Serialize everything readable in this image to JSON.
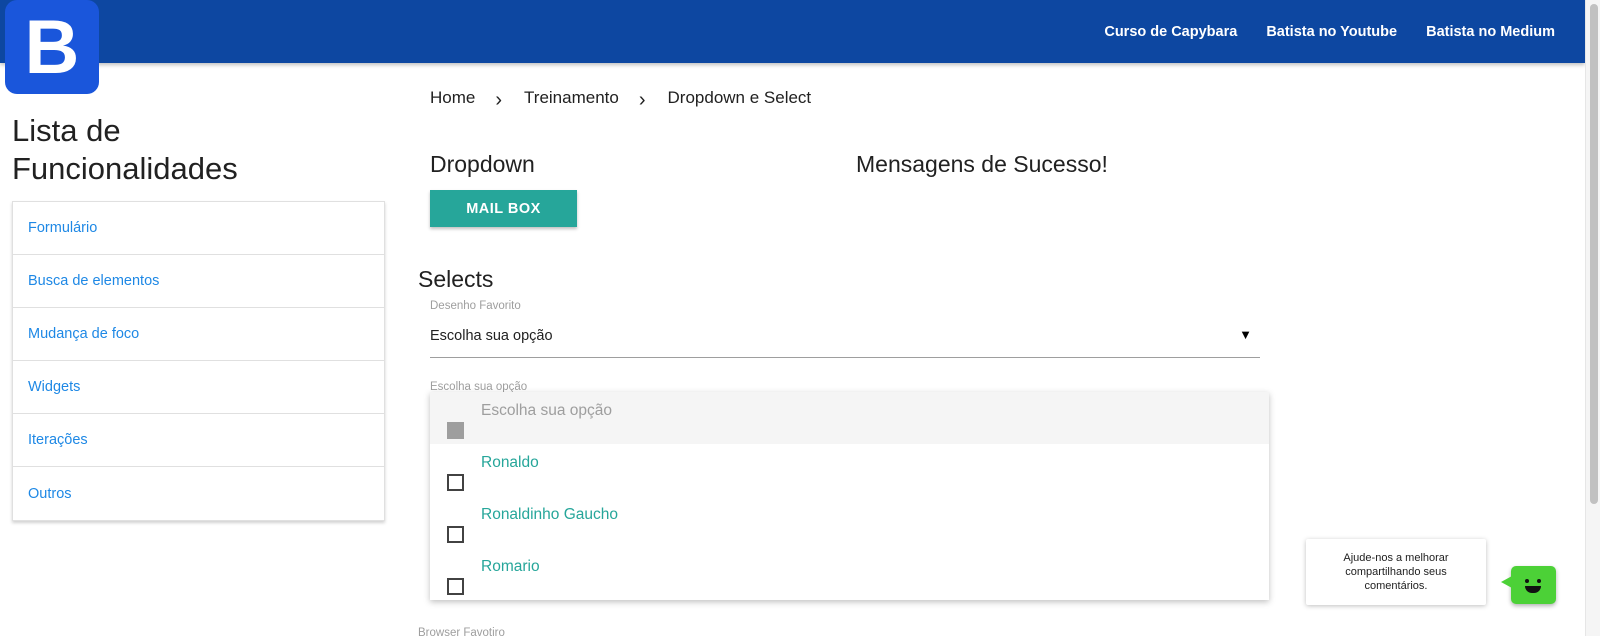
{
  "header": {
    "logo_letter": "B",
    "links": [
      "Curso de Capybara",
      "Batista no Youtube",
      "Batista no Medium"
    ],
    "bg_color": "#0d47a1"
  },
  "sidebar": {
    "title_line1": "Lista de",
    "title_line2": "Funcionalidades",
    "items": [
      {
        "label": "Formulário"
      },
      {
        "label": "Busca de elementos"
      },
      {
        "label": "Mudança de foco"
      },
      {
        "label": "Widgets"
      },
      {
        "label": "Iterações"
      },
      {
        "label": "Outros"
      }
    ]
  },
  "breadcrumb": {
    "items": [
      "Home",
      "Treinamento",
      "Dropdown e Select"
    ],
    "separator_icon": "chevron-right-icon"
  },
  "main": {
    "dropdown_heading": "Dropdown",
    "success_heading": "Mensagens de Sucesso!",
    "mail_button": "MAIL BOX",
    "selects_heading": "Selects",
    "desenho_label": "Desenho Favorito",
    "desenho_value": "Escolha sua opção",
    "caret": "▼",
    "escolha_label": "Escolha sua opção",
    "options": [
      {
        "label": "Escolha sua opção",
        "disabled": true
      },
      {
        "label": "Ronaldo",
        "disabled": false
      },
      {
        "label": "Ronaldinho Gaucho",
        "disabled": false
      },
      {
        "label": "Romario",
        "disabled": false
      }
    ],
    "browser_label": "Browser Favotiro",
    "accent_color": "#26a69a"
  },
  "feedback": {
    "text": "Ajude-nos a melhorar compartilhando seus comentários.",
    "bot_color": "#4cd137"
  }
}
